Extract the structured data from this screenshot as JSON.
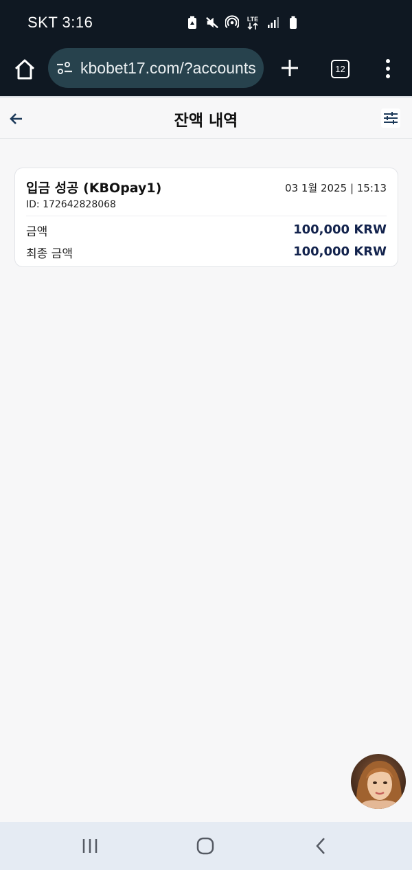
{
  "status_bar": {
    "carrier_time": "SKT 3:16",
    "icons": [
      "battery-saver-icon",
      "mute-icon",
      "hotspot-icon",
      "lte-icon",
      "signal-icon",
      "battery-icon"
    ],
    "lte_label": "LTE"
  },
  "browser": {
    "url": "kbobet17.com/?accounts",
    "tab_count": "12",
    "icons": [
      "home-icon",
      "site-settings-icon",
      "plus-icon",
      "more-vert-icon"
    ]
  },
  "header": {
    "title": "잔액 내역",
    "icons": [
      "back-arrow-icon",
      "filter-sliders-icon"
    ]
  },
  "transactions": [
    {
      "title": "입금 성공 (KBOpay1)",
      "date": "03 1월 2025 | 15:13",
      "id": "ID: 172642828068",
      "rows": [
        {
          "label": "금액",
          "value": "100,000 KRW"
        },
        {
          "label": "최종 금액",
          "value": "100,000 KRW"
        }
      ]
    }
  ],
  "colors": {
    "topbar": "#0f1822",
    "url_pill": "#27424d",
    "amount": "#13234d",
    "background": "#f7f7f8",
    "nav_bar": "#e5ebf3"
  },
  "android_nav": {
    "icons": [
      "recents-icon",
      "home-circle-icon",
      "back-chevron-icon"
    ]
  }
}
